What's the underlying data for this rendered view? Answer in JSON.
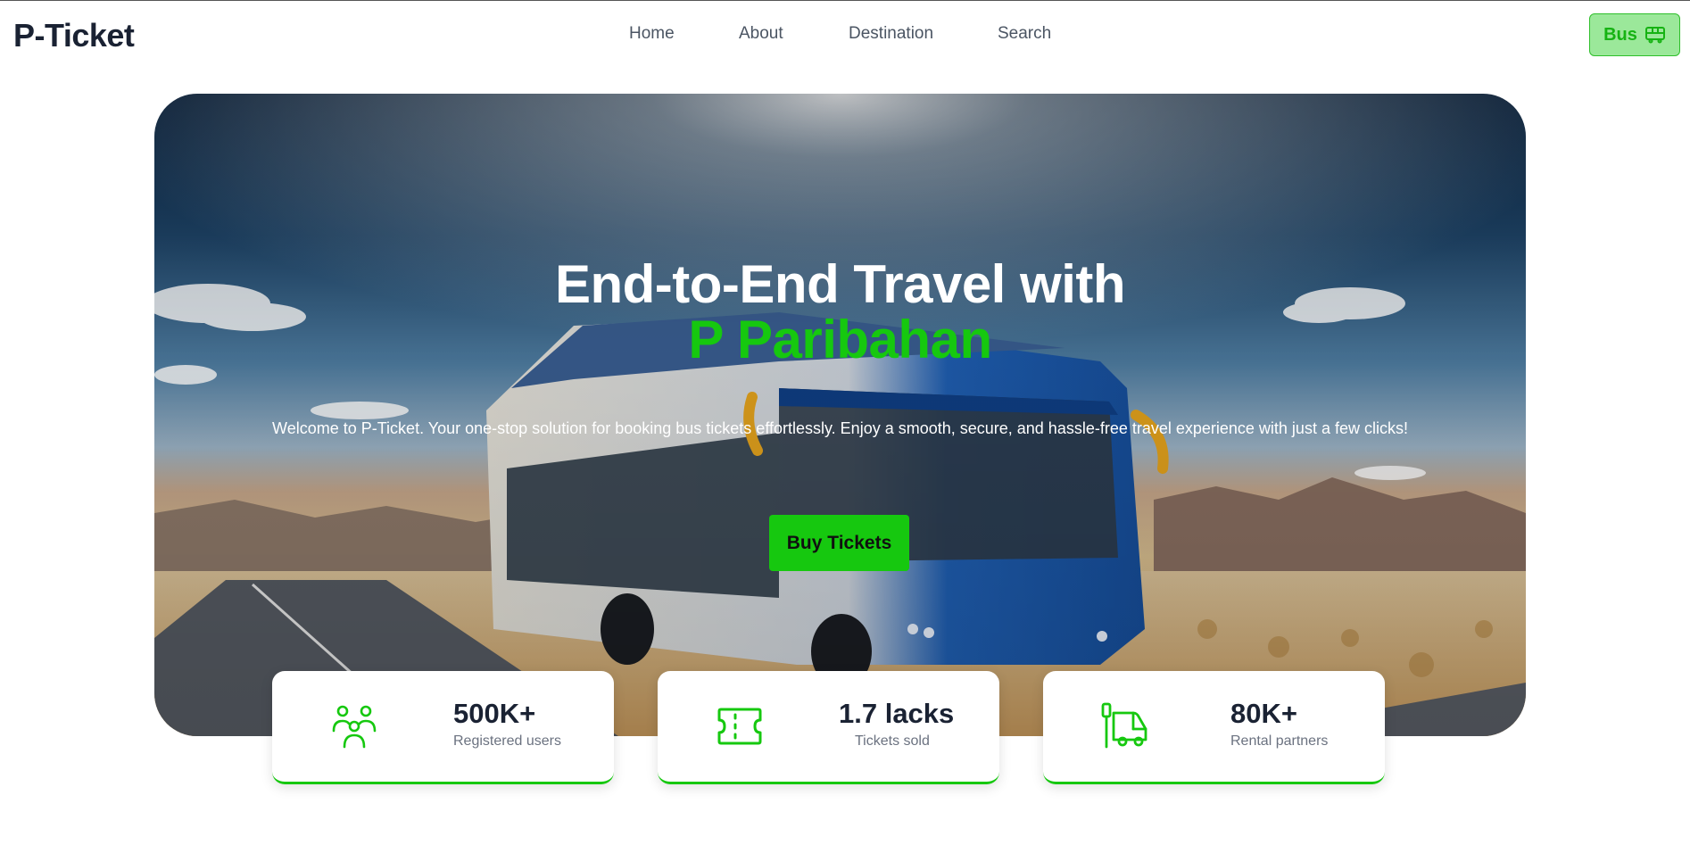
{
  "brand": {
    "name": "P-Ticket"
  },
  "nav": {
    "links": [
      {
        "label": "Home"
      },
      {
        "label": "About"
      },
      {
        "label": "Destination"
      },
      {
        "label": "Search"
      }
    ],
    "bus_button": {
      "label": "Bus",
      "icon": "bus-icon"
    }
  },
  "hero": {
    "title": "End-to-End Travel with",
    "title_accent": "P Paribahan",
    "description": "Welcome to P-Ticket. Your one-stop solution for booking bus tickets effortlessly. Enjoy a smooth, secure, and hassle-free travel experience with just a few clicks!",
    "cta_label": "Buy Tickets",
    "background_image": "bus-on-desert-road"
  },
  "stats": [
    {
      "value": "500K+",
      "label": "Registered users",
      "icon": "users-icon"
    },
    {
      "value": "1.7 lacks",
      "label": "Tickets sold",
      "icon": "ticket-icon"
    },
    {
      "value": "80K+",
      "label": "Rental partners",
      "icon": "truck-icon"
    }
  ],
  "colors": {
    "accent": "#16c80f",
    "accent_light": "#9be89a",
    "text_dark": "#1a2233",
    "text_muted": "#6b7280"
  }
}
